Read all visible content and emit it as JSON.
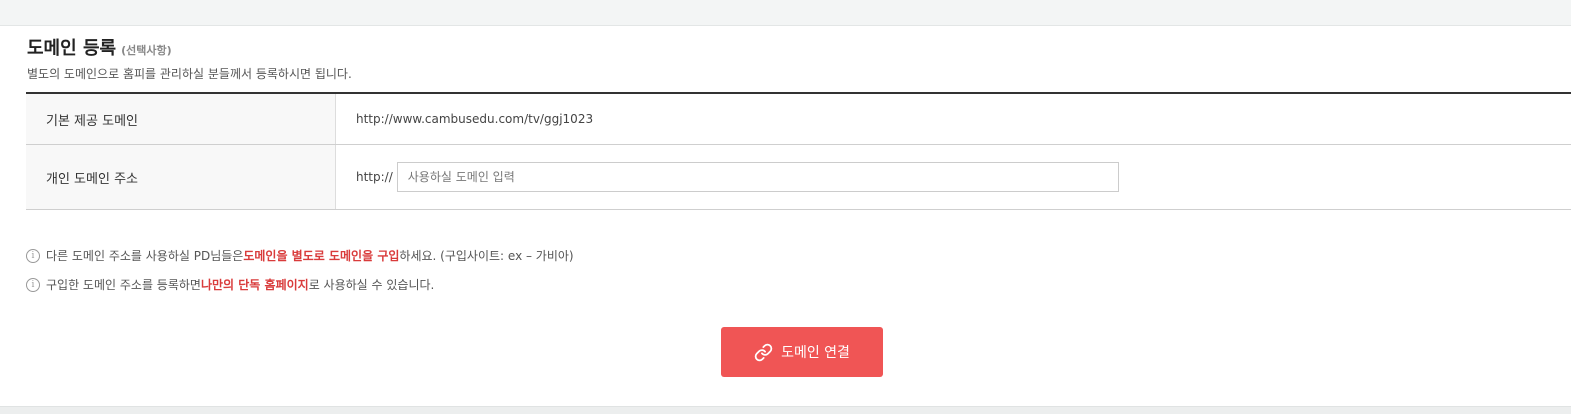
{
  "section": {
    "title": "도메인 등록",
    "title_note": "(선택사항)",
    "description": "별도의 도메인으로 홈피를 관리하실 분들께서 등록하시면 됩니다."
  },
  "table": {
    "rows": [
      {
        "label": "기본 제공 도메인",
        "value": "http://www.cambusedu.com/tv/ggj1023"
      },
      {
        "label": "개인 도메인 주소",
        "prefix": "http://",
        "input_value": "",
        "input_placeholder": "사용하실 도메인 입력"
      }
    ]
  },
  "notices": [
    {
      "icon": "info-circle-icon",
      "before": "다른 도메인 주소를 사용하실 PD님들은 ",
      "highlight": "도메인을 별도로 도메인을 구입",
      "after": "하세요. (구입사이트: ex – 가비아)"
    },
    {
      "icon": "info-circle-icon",
      "before": "구입한 도메인 주소를 등록하면 ",
      "highlight": "나만의 단독 홈페이지",
      "after": "로 사용하실 수 있습니다."
    }
  ],
  "button": {
    "label": "도메인 연결",
    "icon": "link-icon"
  },
  "colors": {
    "accent": "#f05555",
    "highlight_text": "#d93b3b",
    "table_border": "#333333",
    "label_background": "#f8f8f8"
  }
}
